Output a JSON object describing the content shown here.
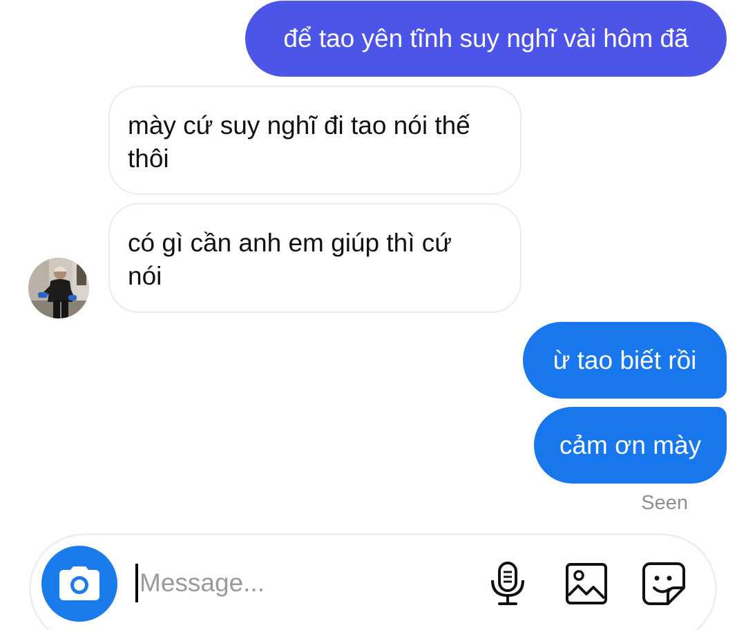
{
  "messages": [
    {
      "direction": "out",
      "text": "để tao yên tĩnh suy nghĩ vài hôm đã"
    },
    {
      "direction": "in",
      "lines": [
        "mày cứ suy nghĩ đi tao nói thế",
        "thôi"
      ]
    },
    {
      "direction": "in",
      "lines": [
        "có gì cần anh em giúp thì cứ",
        "nói"
      ]
    },
    {
      "direction": "out",
      "text": "ừ tao biết rồi"
    },
    {
      "direction": "out",
      "text": "cảm ơn mày"
    }
  ],
  "status": {
    "seen": "Seen"
  },
  "composer": {
    "placeholder": "Message..."
  },
  "colors": {
    "outgoing_gradient_top": "#4d54e8",
    "outgoing_blue": "#1877ec",
    "camera_button": "#1a7bea",
    "incoming_border": "#ececec"
  },
  "icons": [
    "camera-icon",
    "microphone-icon",
    "gallery-icon",
    "sticker-icon"
  ]
}
